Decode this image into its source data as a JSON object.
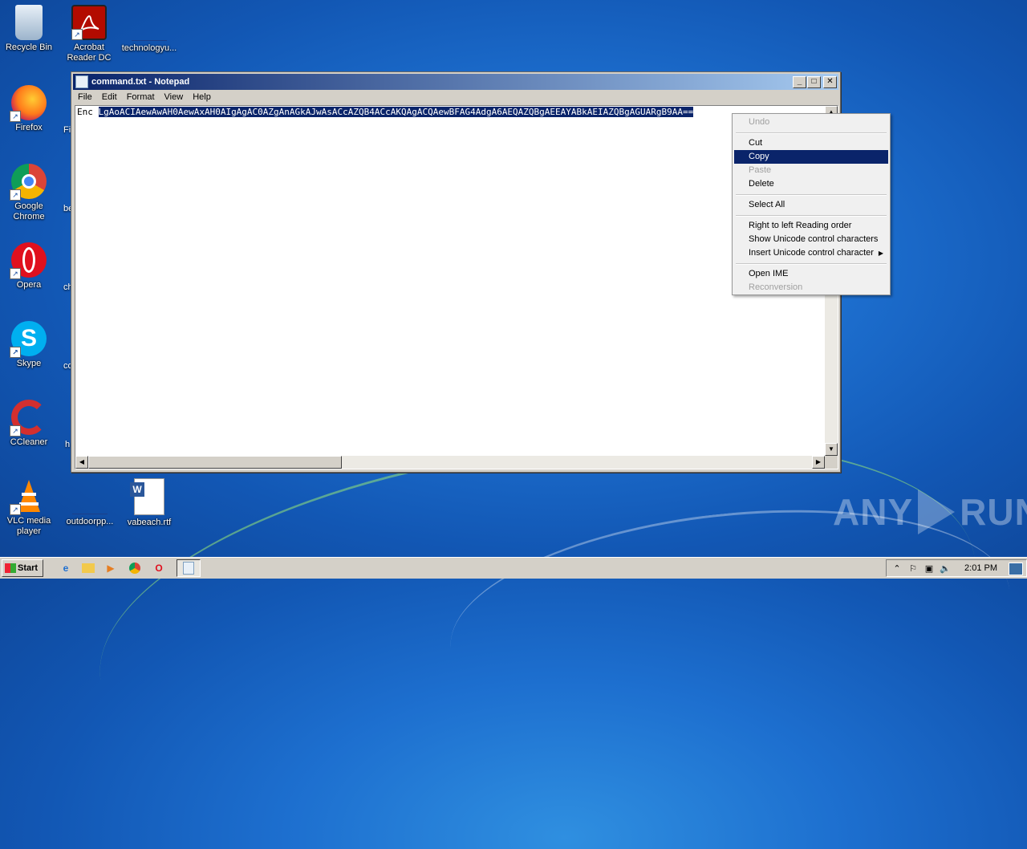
{
  "desktop": {
    "icons": [
      {
        "label": "Recycle Bin",
        "icon": "recycle-bin-icon"
      },
      {
        "label": "Acrobat Reader DC",
        "icon": "acrobat-icon"
      },
      {
        "label": "technologyu...",
        "icon": "blank-file-icon"
      },
      {
        "label": "Firefox",
        "icon": "firefox-icon"
      },
      {
        "label": "Google Chrome",
        "icon": "chrome-icon"
      },
      {
        "label": "Opera",
        "icon": "opera-icon"
      },
      {
        "label": "Skype",
        "icon": "skype-icon"
      },
      {
        "label": "CCleaner",
        "icon": "ccleaner-icon"
      },
      {
        "label": "VLC media player",
        "icon": "vlc-icon"
      },
      {
        "label": "outdoorpp...",
        "icon": "blank-file-icon"
      },
      {
        "label": "vabeach.rtf",
        "icon": "word-doc-icon"
      }
    ],
    "partial_labels": [
      "Fi",
      "be",
      "ch",
      "co",
      "h"
    ]
  },
  "notepad": {
    "title": "command.txt - Notepad",
    "menu": [
      "File",
      "Edit",
      "Format",
      "View",
      "Help"
    ],
    "text_prefix": "Enc ",
    "text_selected": "LgAoACIAewAwAH0AewAxAH0AIgAgAC0AZgAnAGkAJwAsACcAZQB4ACcAKQAgACQAewBFAG4AdgA6AEQAZQBgAEEAYABkAEIAZQBgAGUARgB9AA=="
  },
  "context_menu": {
    "items": [
      {
        "label": "Undo",
        "disabled": true
      },
      {
        "sep": true
      },
      {
        "label": "Cut"
      },
      {
        "label": "Copy",
        "highlighted": true
      },
      {
        "label": "Paste",
        "disabled": true
      },
      {
        "label": "Delete"
      },
      {
        "sep": true
      },
      {
        "label": "Select All"
      },
      {
        "sep": true
      },
      {
        "label": "Right to left Reading order"
      },
      {
        "label": "Show Unicode control characters"
      },
      {
        "label": "Insert Unicode control character",
        "submenu": true
      },
      {
        "sep": true
      },
      {
        "label": "Open IME"
      },
      {
        "label": "Reconversion",
        "disabled": true
      }
    ]
  },
  "taskbar": {
    "start_label": "Start",
    "clock": "2:01 PM"
  },
  "watermark": {
    "left": "ANY",
    "right": "RUN"
  },
  "colors": {
    "selection": "#0a246a",
    "titlebar_start": "#0a246a",
    "titlebar_end": "#a6caf0"
  }
}
